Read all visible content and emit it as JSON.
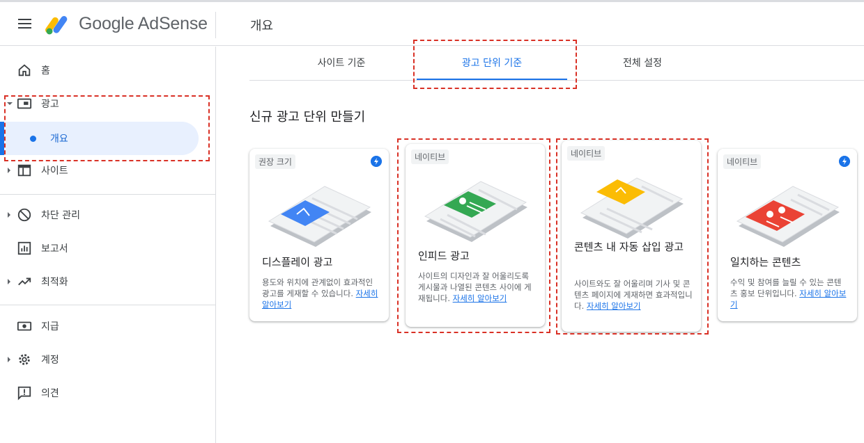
{
  "header": {
    "brand": "Google AdSense",
    "page_title": "개요"
  },
  "sidebar": {
    "items": [
      {
        "label": "홈",
        "icon": "home-icon"
      },
      {
        "label": "광고",
        "icon": "ads-icon"
      },
      {
        "label": "개요"
      },
      {
        "label": "사이트",
        "icon": "sites-icon"
      },
      {
        "label": "차단 관리",
        "icon": "block-icon"
      },
      {
        "label": "보고서",
        "icon": "reports-icon"
      },
      {
        "label": "최적화",
        "icon": "optimize-icon"
      },
      {
        "label": "지급",
        "icon": "payments-icon"
      },
      {
        "label": "계정",
        "icon": "account-icon"
      },
      {
        "label": "의견",
        "icon": "feedback-icon"
      }
    ]
  },
  "tabs": [
    {
      "label": "사이트 기준"
    },
    {
      "label": "광고 단위 기준",
      "active": true
    },
    {
      "label": "전체 설정"
    }
  ],
  "section_title": "신규 광고 단위 만들기",
  "cards": [
    {
      "badge": "권장 크기",
      "title": "디스플레이 광고",
      "desc": "용도와 위치에 관계없이 효과적인 광고를 게재할 수 있습니다.",
      "link": "자세히 알아보기",
      "accent": "#4285f4"
    },
    {
      "badge": "네이티브",
      "title": "인피드 광고",
      "desc": "사이트의 디자인과 잘 어울리도록 게시물과 나열된 콘텐츠 사이에 게재됩니다.",
      "link": "자세히 알아보기",
      "accent": "#34a853"
    },
    {
      "badge": "네이티브",
      "title": "콘텐츠 내 자동 삽입 광고",
      "desc": "사이트와도 잘 어울리며 기사 및 콘텐츠 페이지에 게재하면 효과적입니다.",
      "link": "자세히 알아보기",
      "accent": "#fbbc04"
    },
    {
      "badge": "네이티브",
      "title": "일치하는 콘텐츠",
      "desc": "수익 및 참여를 늘릴 수 있는 콘텐츠 홍보 단위입니다.",
      "link": "자세히 알아보기",
      "accent": "#ea4335"
    }
  ],
  "colors": {
    "primary": "#1a73e8",
    "highlight": "#d93025"
  }
}
